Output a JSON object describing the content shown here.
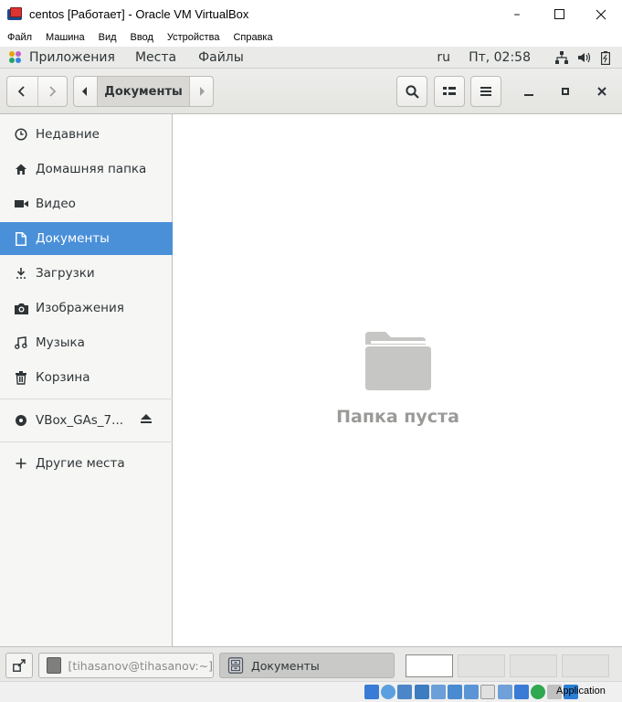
{
  "host_window": {
    "title": "centos [Работает] - Oracle VM VirtualBox",
    "controls": [
      "minimize",
      "maximize",
      "close"
    ]
  },
  "vbox_menu": {
    "items": [
      "Файл",
      "Машина",
      "Вид",
      "Ввод",
      "Устройства",
      "Справка"
    ]
  },
  "gnome_top_bar": {
    "applications": "Приложения",
    "places": "Места",
    "files": "Файлы",
    "language": "ru",
    "clock": "Пт, 02:58",
    "tray_icons": [
      "network-wired-icon",
      "volume-icon",
      "battery-icon"
    ]
  },
  "headerbar": {
    "path_current": "Документы",
    "buttons": [
      "back",
      "forward",
      "search",
      "view-toggle",
      "menu",
      "minimize",
      "maximize",
      "close"
    ]
  },
  "sidebar": {
    "items": [
      {
        "label": "Недавние",
        "icon": "recent-icon"
      },
      {
        "label": "Домашняя папка",
        "icon": "home-icon"
      },
      {
        "label": "Видео",
        "icon": "video-icon"
      },
      {
        "label": "Документы",
        "icon": "document-icon",
        "active": true
      },
      {
        "label": "Загрузки",
        "icon": "download-icon"
      },
      {
        "label": "Изображения",
        "icon": "camera-icon"
      },
      {
        "label": "Музыка",
        "icon": "music-icon"
      },
      {
        "label": "Корзина",
        "icon": "trash-icon"
      }
    ],
    "device": {
      "label": "VBox_GAs_7...",
      "icon": "disc-icon"
    },
    "other_places": "Другие места"
  },
  "content": {
    "empty_message": "Папка пуста"
  },
  "taskbar": {
    "tasks": [
      {
        "label": "[tihasanov@tihasanov:~]",
        "active": false
      },
      {
        "label": "Документы",
        "active": true
      }
    ],
    "workspaces": 4,
    "active_workspace": 1
  },
  "vbox_status": {
    "host_key_label": "Application"
  },
  "colors": {
    "selection": "#4a90d9",
    "sidebar_bg": "#f6f6f5",
    "headerbar_bg": "#e8e8e6"
  }
}
